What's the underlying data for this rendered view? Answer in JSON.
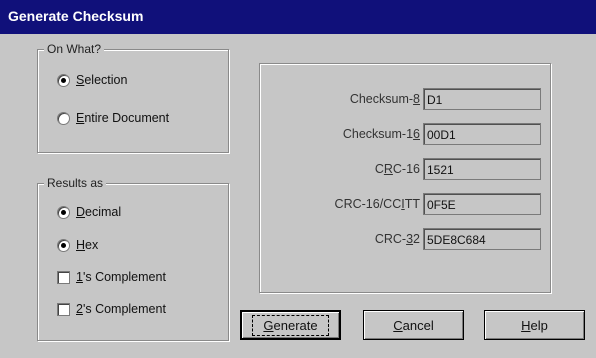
{
  "window": {
    "title": "Generate Checksum"
  },
  "on_what": {
    "legend": "On What?",
    "options": [
      {
        "pre": "",
        "ul": "S",
        "post": "election",
        "selected": true
      },
      {
        "pre": "",
        "ul": "E",
        "post": "ntire Document",
        "selected": false
      }
    ]
  },
  "results_as": {
    "legend": "Results as",
    "radios": [
      {
        "pre": "",
        "ul": "D",
        "post": "ecimal",
        "selected": true
      },
      {
        "pre": "",
        "ul": "H",
        "post": "ex",
        "selected": true
      }
    ],
    "checks": [
      {
        "pre": "",
        "ul": "1",
        "post": "'s Complement",
        "checked": false
      },
      {
        "pre": "",
        "ul": "2",
        "post": "'s Complement",
        "checked": false
      }
    ]
  },
  "fields": [
    {
      "pre": "Checksum-",
      "ul": "8",
      "post": "",
      "value": "D1"
    },
    {
      "pre": "Checksum-1",
      "ul": "6",
      "post": "",
      "value": "00D1"
    },
    {
      "pre": "C",
      "ul": "R",
      "post": "C-16",
      "value": "1521"
    },
    {
      "pre": "CRC-16/CC",
      "ul": "I",
      "post": "TT",
      "value": "0F5E"
    },
    {
      "pre": "CRC-",
      "ul": "3",
      "post": "2",
      "value": "5DE8C684"
    }
  ],
  "buttons": {
    "generate": {
      "pre": "",
      "ul": "G",
      "post": "enerate"
    },
    "cancel": {
      "pre": "",
      "ul": "C",
      "post": "ancel"
    },
    "help": {
      "pre": "",
      "ul": "H",
      "post": "elp"
    }
  }
}
